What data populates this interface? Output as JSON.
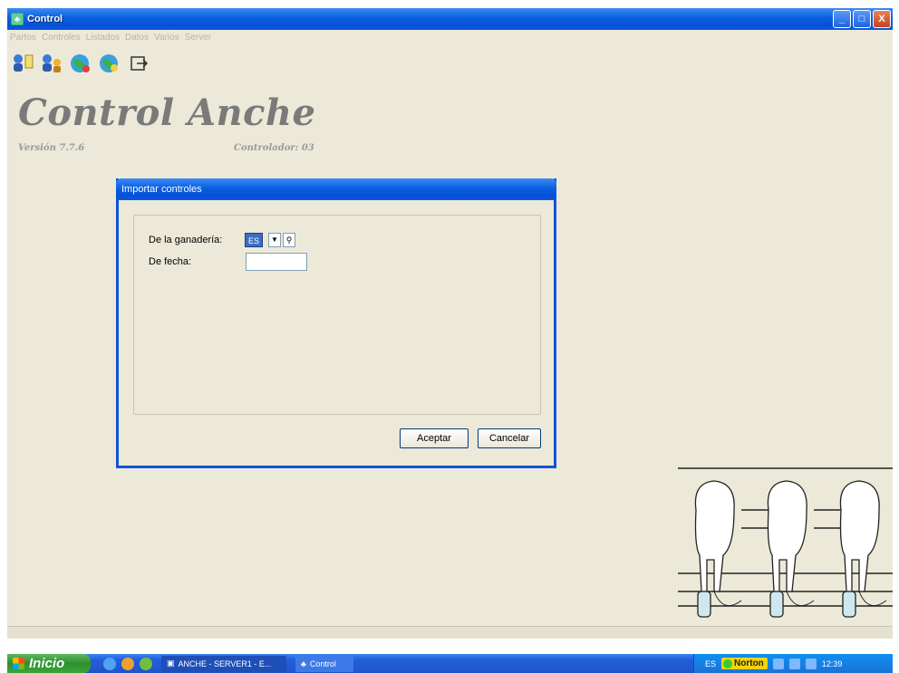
{
  "window": {
    "title": "Control",
    "minimize": "_",
    "maximize": "□",
    "close": "X"
  },
  "menu": [
    "Partos",
    "Controles",
    "Listados",
    "Datos",
    "Varios",
    "Server"
  ],
  "toolbar": [
    {
      "icon": "user-list-icon"
    },
    {
      "icon": "users-icon"
    },
    {
      "icon": "globe-icon"
    },
    {
      "icon": "globe-user-icon"
    },
    {
      "icon": "exit-icon"
    }
  ],
  "brand": {
    "title": "Control Anche",
    "version": "Versión 7.7.6",
    "controlador": "Controlador: 03"
  },
  "dialog": {
    "title": "Importar controles",
    "herd_label": "De la ganadería:",
    "herd_code": "ES",
    "date_label": "De fecha:",
    "date_value": "",
    "accept_label": "Aceptar",
    "cancel_label": "Cancelar"
  },
  "taskbar": {
    "start_label": "Inicio",
    "tasks": [
      "ANCHE - SERVER1 - E...",
      "Control"
    ],
    "language": "ES",
    "norton": "Norton",
    "clock": "12:39"
  },
  "colors": {
    "titlebar": "#0a5fe0",
    "taskbar": "#245edb",
    "start": "#2f8f2f",
    "app_bg": "#ece9d8"
  }
}
